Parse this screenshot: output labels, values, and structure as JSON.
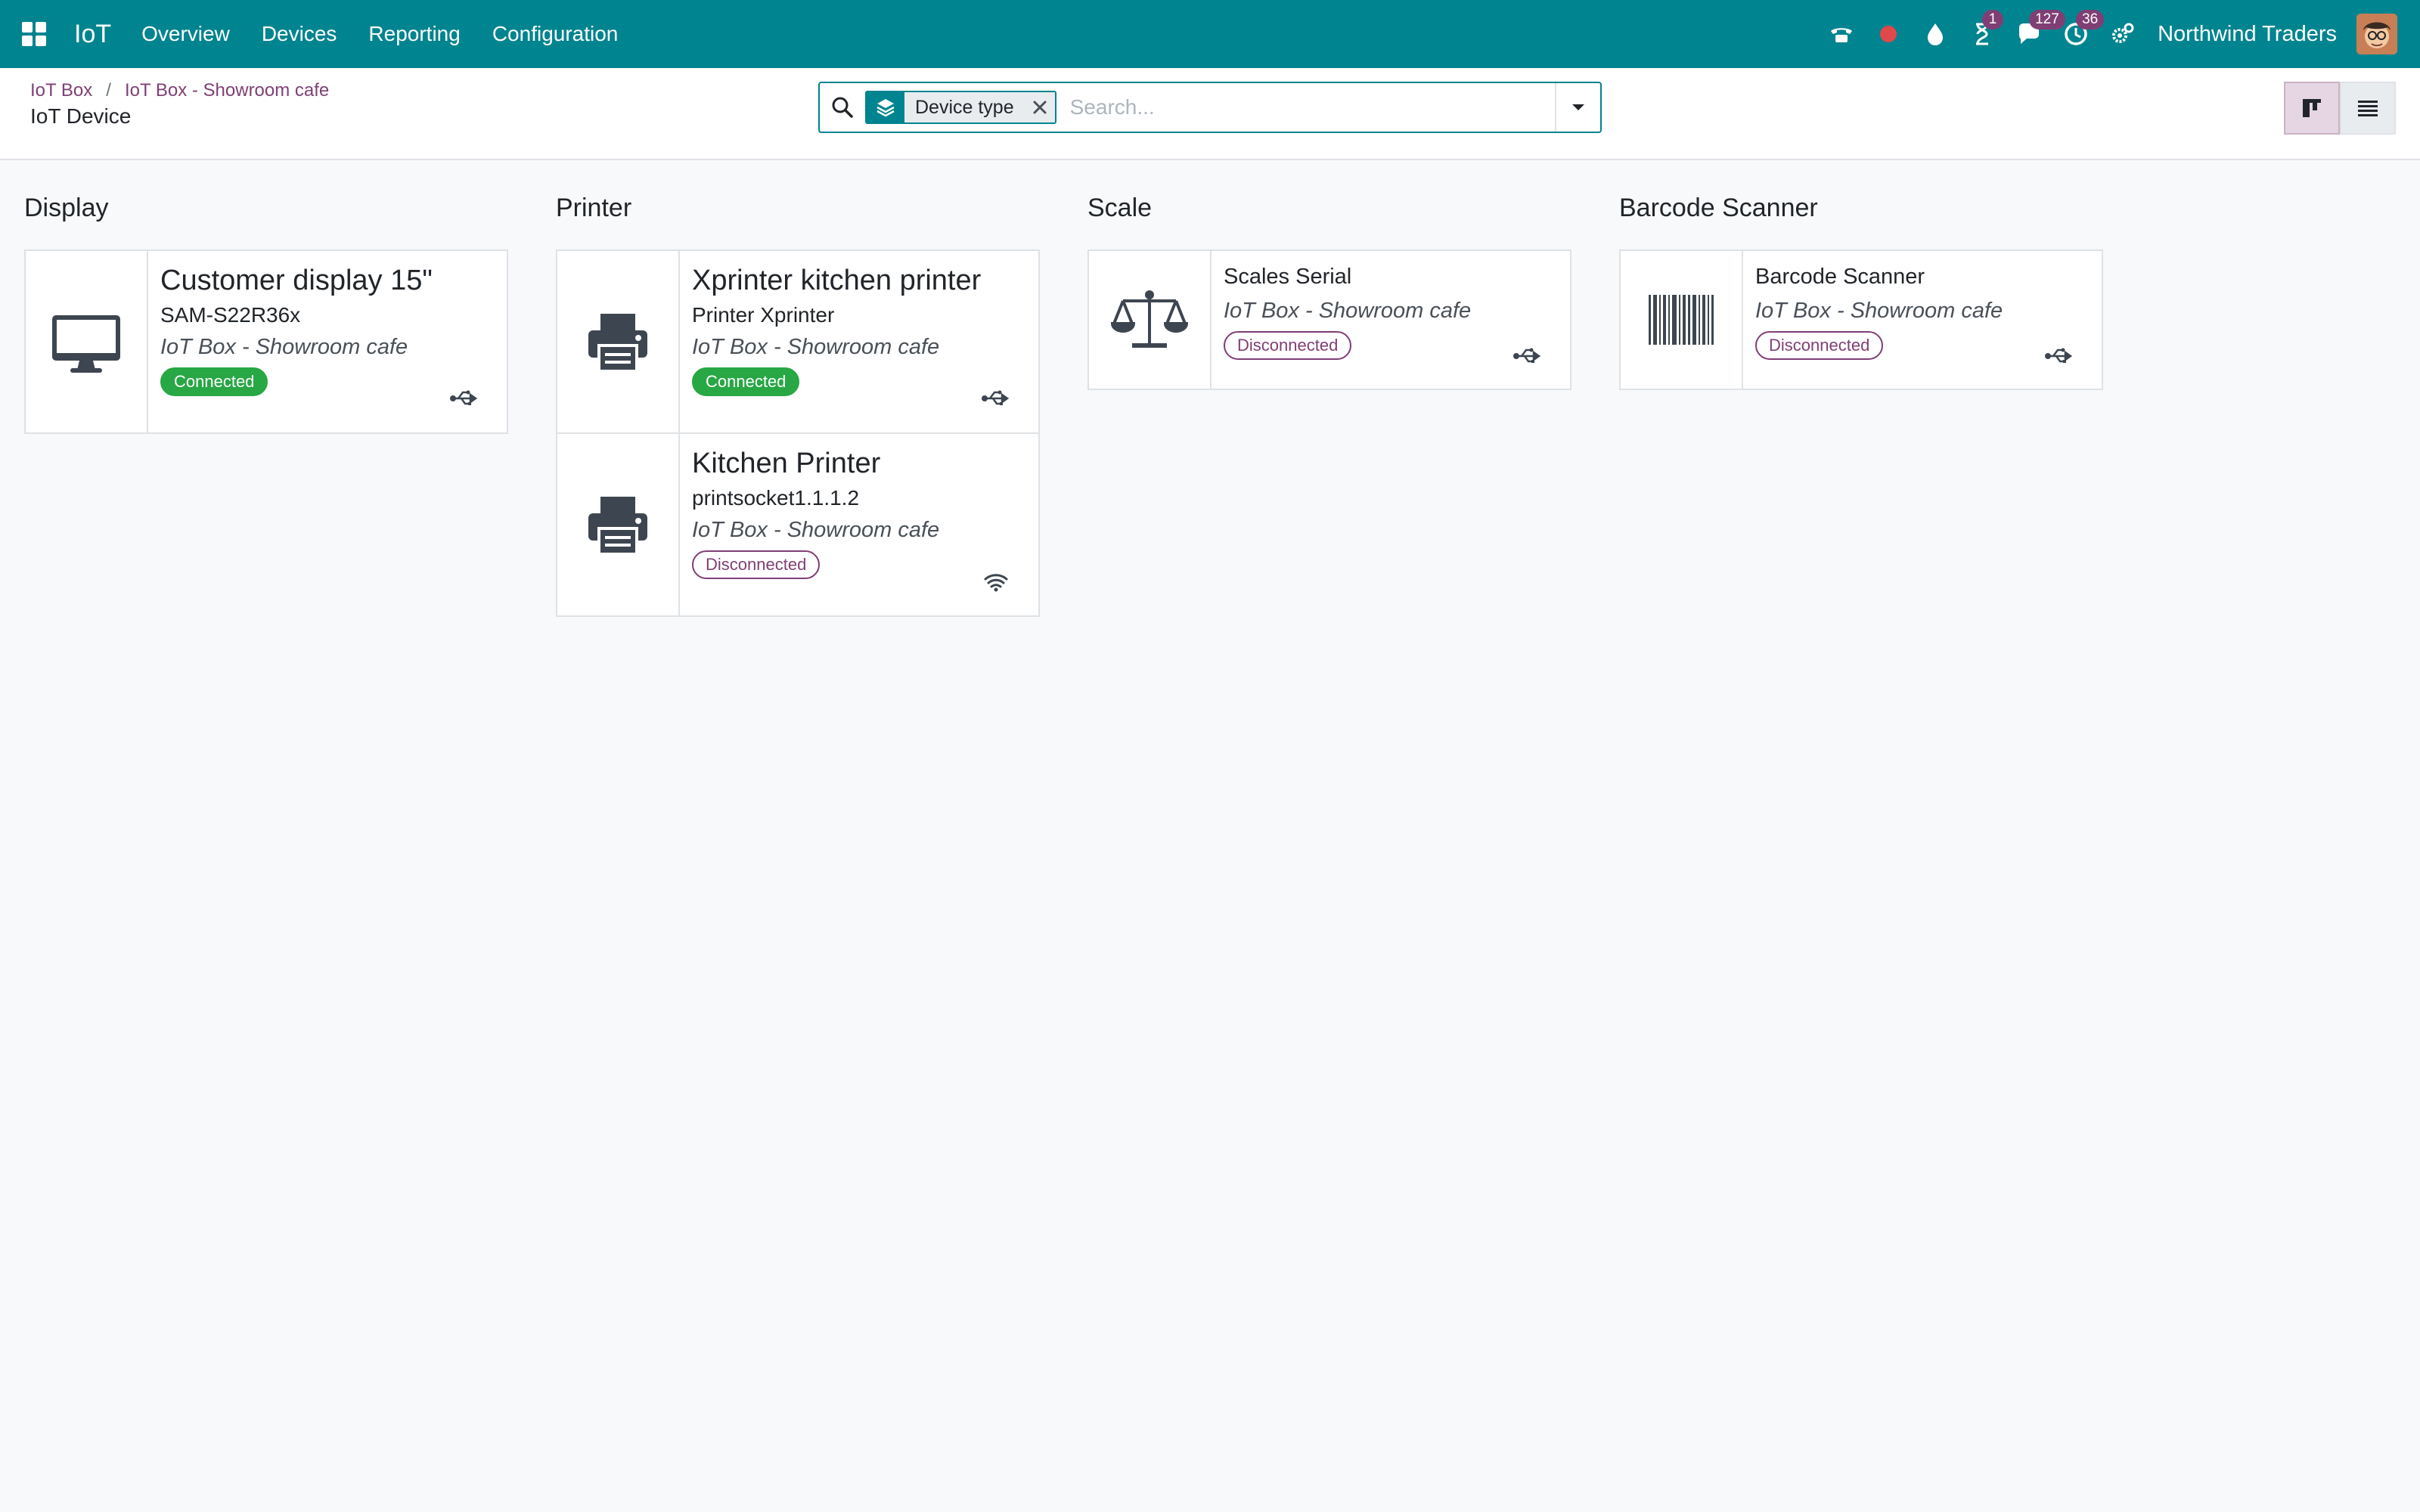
{
  "navbar": {
    "brand": "IoT",
    "menu": [
      "Overview",
      "Devices",
      "Reporting",
      "Configuration"
    ],
    "activity_badges": {
      "activities": "1",
      "messages": "127",
      "timers": "36"
    },
    "company": "Northwind Traders"
  },
  "control_panel": {
    "breadcrumb": [
      "IoT Box",
      "IoT Box - Showroom cafe"
    ],
    "breadcrumb_separator": "/",
    "title": "IoT Device",
    "search": {
      "facet_label": "Device type",
      "placeholder": "Search..."
    }
  },
  "kanban": {
    "columns": [
      {
        "title": "Display",
        "cards": [
          {
            "name": "Customer display 15\"",
            "model": "SAM-S22R36x",
            "box": "IoT Box - Showroom cafe",
            "status": "Connected",
            "icon": "monitor-icon",
            "connection": "usb-icon"
          }
        ]
      },
      {
        "title": "Printer",
        "cards": [
          {
            "name": "Xprinter kitchen printer",
            "model": "Printer Xprinter",
            "box": "IoT Box - Showroom cafe",
            "status": "Connected",
            "icon": "printer-icon",
            "connection": "usb-icon"
          },
          {
            "name": "Kitchen Printer",
            "model": "printsocket1.1.1.2",
            "box": "IoT Box - Showroom cafe",
            "status": "Disconnected",
            "icon": "printer-icon",
            "connection": "wifi-icon"
          }
        ]
      },
      {
        "title": "Scale",
        "cards": [
          {
            "name": "Scales Serial",
            "box": "IoT Box - Showroom cafe",
            "status": "Disconnected",
            "icon": "scale-icon",
            "connection": "usb-icon"
          }
        ]
      },
      {
        "title": "Barcode Scanner",
        "cards": [
          {
            "name": "Barcode Scanner",
            "box": "IoT Box - Showroom cafe",
            "status": "Disconnected",
            "icon": "barcode-icon",
            "connection": "usb-icon"
          }
        ]
      }
    ]
  },
  "colors": {
    "brand": "#00848f",
    "accent": "#7f3f74",
    "connected": "#28a745"
  }
}
